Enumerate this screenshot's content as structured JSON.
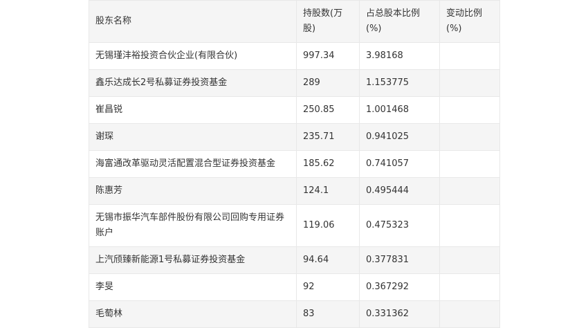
{
  "table": {
    "headers": [
      "股东名称",
      "持股数(万股)",
      "占总股本比例(%)",
      "变动比例(%)"
    ],
    "rows": [
      [
        "无锡瑾沣裕投资合伙企业(有限合伙)",
        "997.34",
        "3.98168",
        ""
      ],
      [
        "鑫乐达成长2号私募证券投资基金",
        "289",
        "1.153775",
        ""
      ],
      [
        "崔昌锐",
        "250.85",
        "1.001468",
        ""
      ],
      [
        "谢琛",
        "235.71",
        "0.941025",
        ""
      ],
      [
        "海富通改革驱动灵活配置混合型证券投资基金",
        "185.62",
        "0.741057",
        ""
      ],
      [
        "陈惠芳",
        "124.1",
        "0.495444",
        ""
      ],
      [
        "无锡市振华汽车部件股份有限公司回购专用证券账户",
        "119.06",
        "0.475323",
        ""
      ],
      [
        "上汽颀臻新能源1号私募证券投资基金",
        "94.64",
        "0.377831",
        ""
      ],
      [
        "李旻",
        "92",
        "0.367292",
        ""
      ],
      [
        "毛萄林",
        "83",
        "0.331362",
        ""
      ]
    ]
  }
}
